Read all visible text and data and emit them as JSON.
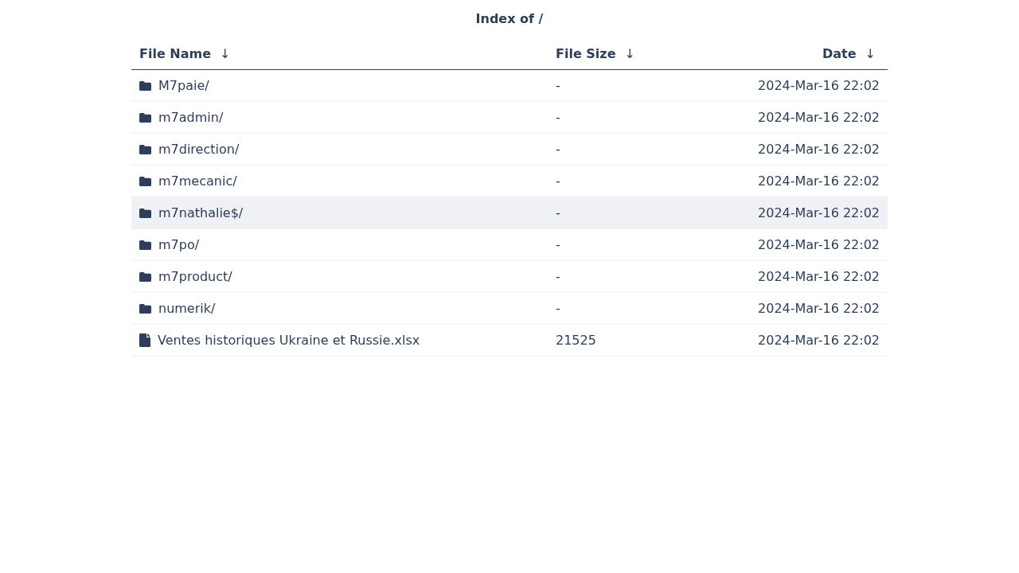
{
  "title": "Index of /",
  "table": {
    "columns": [
      {
        "label": "File Name",
        "sort_arrow": "↓"
      },
      {
        "label": "File Size",
        "sort_arrow": "↓"
      },
      {
        "label": "Date",
        "sort_arrow": "↓"
      }
    ],
    "rows": [
      {
        "kind": "folder",
        "name": "M7paie/",
        "size": "-",
        "date": "2024-Mar-16 22:02",
        "selected": false
      },
      {
        "kind": "folder",
        "name": "m7admin/",
        "size": "-",
        "date": "2024-Mar-16 22:02",
        "selected": false
      },
      {
        "kind": "folder",
        "name": "m7direction/",
        "size": "-",
        "date": "2024-Mar-16 22:02",
        "selected": false
      },
      {
        "kind": "folder",
        "name": "m7mecanic/",
        "size": "-",
        "date": "2024-Mar-16 22:02",
        "selected": false
      },
      {
        "kind": "folder",
        "name": "m7nathalie$/",
        "size": "-",
        "date": "2024-Mar-16 22:02",
        "selected": true
      },
      {
        "kind": "folder",
        "name": "m7po/",
        "size": "-",
        "date": "2024-Mar-16 22:02",
        "selected": false
      },
      {
        "kind": "folder",
        "name": "m7product/",
        "size": "-",
        "date": "2024-Mar-16 22:02",
        "selected": false
      },
      {
        "kind": "folder",
        "name": "numerik/",
        "size": "-",
        "date": "2024-Mar-16 22:02",
        "selected": false
      },
      {
        "kind": "file",
        "name": "Ventes historiques Ukraine et Russie.xlsx",
        "size": "21525",
        "date": "2024-Mar-16 22:02",
        "selected": false
      }
    ]
  }
}
